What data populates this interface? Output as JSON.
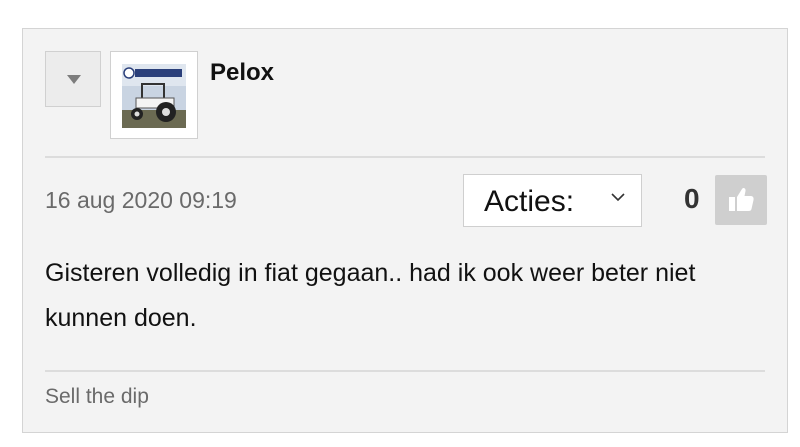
{
  "post": {
    "username": "Pelox",
    "avatar_icon": "tractor-avatar-image",
    "avatar_logo_text": "Lamborghini",
    "timestamp": "16 aug 2020 09:19",
    "actions_label": "Acties:",
    "like_count": "0",
    "content": "Gisteren volledig in fiat gegaan.. had ik ook weer beter niet kunnen doen.",
    "signature": "Sell the dip"
  },
  "icons": {
    "collapse": "triangle-down-icon",
    "actions_chevron": "chevron-down-icon",
    "like": "thumbs-up-icon"
  },
  "colors": {
    "card_background": "#f3f3f3",
    "border": "#d4d4d4",
    "like_button": "#cfcfcf",
    "muted_text": "#6a6a6a"
  }
}
